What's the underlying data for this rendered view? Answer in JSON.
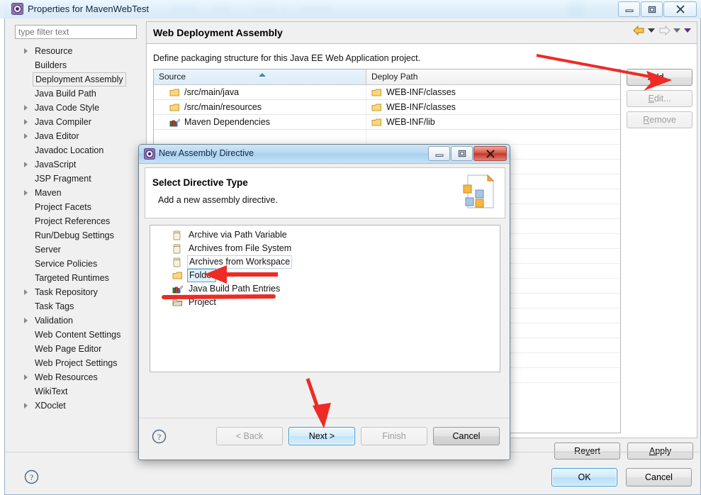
{
  "window": {
    "title": "Properties for MavenWebTest",
    "icon": "eclipse-properties-icon",
    "buttons": {
      "minimize": "–",
      "maximize": "▣",
      "close": "✕"
    }
  },
  "sidebar": {
    "filter": {
      "placeholder": "type filter text",
      "value": ""
    },
    "items": [
      {
        "label": "Resource",
        "expandable": true,
        "selected": false
      },
      {
        "label": "Builders",
        "expandable": false,
        "selected": false
      },
      {
        "label": "Deployment Assembly",
        "expandable": false,
        "selected": true
      },
      {
        "label": "Java Build Path",
        "expandable": false,
        "selected": false
      },
      {
        "label": "Java Code Style",
        "expandable": true,
        "selected": false
      },
      {
        "label": "Java Compiler",
        "expandable": true,
        "selected": false
      },
      {
        "label": "Java Editor",
        "expandable": true,
        "selected": false
      },
      {
        "label": "Javadoc Location",
        "expandable": false,
        "selected": false
      },
      {
        "label": "JavaScript",
        "expandable": true,
        "selected": false
      },
      {
        "label": "JSP Fragment",
        "expandable": false,
        "selected": false
      },
      {
        "label": "Maven",
        "expandable": true,
        "selected": false
      },
      {
        "label": "Project Facets",
        "expandable": false,
        "selected": false
      },
      {
        "label": "Project References",
        "expandable": false,
        "selected": false
      },
      {
        "label": "Run/Debug Settings",
        "expandable": false,
        "selected": false
      },
      {
        "label": "Server",
        "expandable": false,
        "selected": false
      },
      {
        "label": "Service Policies",
        "expandable": false,
        "selected": false
      },
      {
        "label": "Targeted Runtimes",
        "expandable": false,
        "selected": false
      },
      {
        "label": "Task Repository",
        "expandable": true,
        "selected": false
      },
      {
        "label": "Task Tags",
        "expandable": false,
        "selected": false
      },
      {
        "label": "Validation",
        "expandable": true,
        "selected": false
      },
      {
        "label": "Web Content Settings",
        "expandable": false,
        "selected": false
      },
      {
        "label": "Web Page Editor",
        "expandable": false,
        "selected": false
      },
      {
        "label": "Web Project Settings",
        "expandable": false,
        "selected": false
      },
      {
        "label": "Web Resources",
        "expandable": true,
        "selected": false
      },
      {
        "label": "WikiText",
        "expandable": false,
        "selected": false
      },
      {
        "label": "XDoclet",
        "expandable": true,
        "selected": false
      }
    ]
  },
  "content": {
    "title": "Web Deployment Assembly",
    "description": "Define packaging structure for this Java EE Web Application project.",
    "nav": {
      "back_icon": "back-arrow-icon",
      "back_menu_icon": "chevron-down-icon",
      "forward_icon": "forward-arrow-icon",
      "forward_menu_icon": "chevron-down-icon",
      "view_menu_icon": "chevron-down-icon"
    },
    "table": {
      "columns": [
        "Source",
        "Deploy Path"
      ],
      "sort_column": "Source",
      "sort_direction": "asc",
      "rows": [
        {
          "source": "/src/main/java",
          "source_icon": "folder-icon",
          "deploy": "WEB-INF/classes",
          "deploy_icon": "folder-icon"
        },
        {
          "source": "/src/main/resources",
          "source_icon": "folder-icon",
          "deploy": "WEB-INF/classes",
          "deploy_icon": "folder-icon"
        },
        {
          "source": "Maven Dependencies",
          "source_icon": "library-icon",
          "deploy": "WEB-INF/lib",
          "deploy_icon": "folder-icon"
        }
      ],
      "empty_row_count": 17
    },
    "side_buttons": [
      {
        "label": "Add...",
        "mnemonic": "d",
        "enabled": true
      },
      {
        "label": "Edit...",
        "mnemonic": "E",
        "enabled": false
      },
      {
        "label": "Remove",
        "mnemonic": "R",
        "enabled": false
      }
    ],
    "footer_buttons": [
      {
        "label": "Revert",
        "mnemonic": "v",
        "enabled": true
      },
      {
        "label": "Apply",
        "mnemonic": "A",
        "enabled": true
      }
    ]
  },
  "main_footer": {
    "help_icon": "help-question-icon",
    "buttons": [
      {
        "label": "OK",
        "default": true
      },
      {
        "label": "Cancel",
        "default": false
      }
    ]
  },
  "dialog": {
    "title": "New Assembly Directive",
    "icon": "eclipse-wizard-icon",
    "title_buttons": {
      "minimize": "–",
      "maximize": "▣",
      "close": "✕"
    },
    "heading": "Select Directive Type",
    "subheading": "Add a new assembly directive.",
    "banner_icon": "wizard-banner-icon",
    "list": [
      {
        "label": "Archive via Path Variable",
        "icon": "jar-icon",
        "state": "normal"
      },
      {
        "label": "Archives from File System",
        "icon": "jar-icon",
        "state": "normal"
      },
      {
        "label": "Archives from Workspace",
        "icon": "jar-icon",
        "state": "previous"
      },
      {
        "label": "Folder",
        "icon": "folder-icon",
        "state": "selected"
      },
      {
        "label": "Java Build Path Entries",
        "icon": "library-icon",
        "state": "normal"
      },
      {
        "label": "Project",
        "icon": "project-folder-icon",
        "state": "normal"
      }
    ],
    "help_icon": "help-question-icon",
    "buttons": [
      {
        "label": "< Back",
        "enabled": false,
        "focused": false
      },
      {
        "label": "Next >",
        "enabled": true,
        "focused": true
      },
      {
        "label": "Finish",
        "enabled": false,
        "focused": false
      },
      {
        "label": "Cancel",
        "enabled": true,
        "focused": false
      }
    ]
  },
  "annotations": {
    "color": "#ee2b24",
    "arrow_to_add": "red-arrow-to-add-button",
    "arrow_to_folder": "red-arrow-to-folder-item",
    "underline_java_build_path": "red-underline-java-build-path",
    "arrow_to_next": "red-arrow-to-next-button"
  }
}
